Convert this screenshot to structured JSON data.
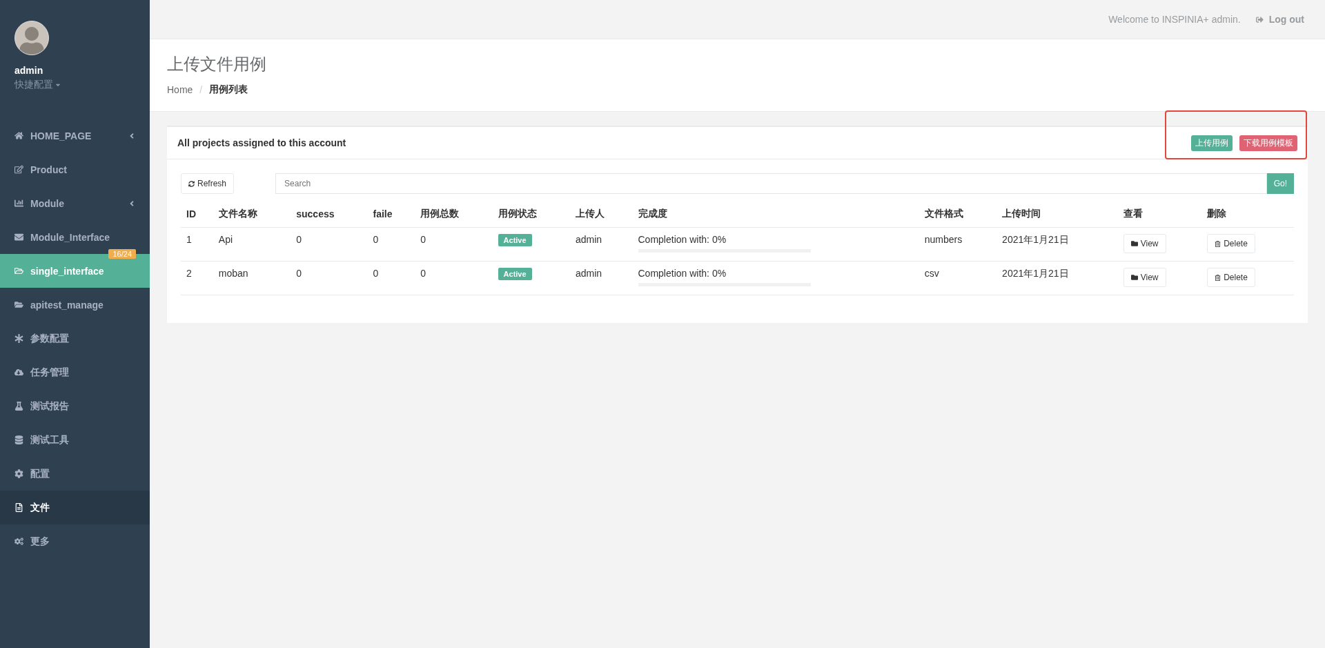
{
  "sidebar": {
    "user": {
      "name": "admin",
      "menu": "快捷配置"
    },
    "items": [
      {
        "label": "HOME_PAGE",
        "selected": false,
        "highlighted": false,
        "has_submenu": true
      },
      {
        "label": "Product",
        "selected": false,
        "highlighted": false,
        "has_submenu": false
      },
      {
        "label": "Module",
        "selected": false,
        "highlighted": false,
        "has_submenu": true
      },
      {
        "label": "Module_Interface",
        "selected": false,
        "highlighted": false,
        "has_submenu": false,
        "badge": "16/24"
      },
      {
        "label": "single_interface",
        "selected": true,
        "highlighted": false,
        "has_submenu": false
      },
      {
        "label": "apitest_manage",
        "selected": false,
        "highlighted": false,
        "has_submenu": false
      },
      {
        "label": "参数配置",
        "selected": false,
        "highlighted": false,
        "has_submenu": false
      },
      {
        "label": "任务管理",
        "selected": false,
        "highlighted": false,
        "has_submenu": false
      },
      {
        "label": "测试报告",
        "selected": false,
        "highlighted": false,
        "has_submenu": false
      },
      {
        "label": "测试工具",
        "selected": false,
        "highlighted": false,
        "has_submenu": false
      },
      {
        "label": "配置",
        "selected": false,
        "highlighted": false,
        "has_submenu": false
      },
      {
        "label": "文件",
        "selected": false,
        "highlighted": true,
        "has_submenu": false
      },
      {
        "label": "更多",
        "selected": false,
        "highlighted": false,
        "has_submenu": false
      }
    ]
  },
  "top_bar": {
    "welcome": "Welcome to INSPINIA+ admin.",
    "logout": "Log out"
  },
  "page_heading": {
    "title": "上传文件用例",
    "breadcrumb": [
      "Home",
      "用例列表"
    ],
    "separator": "/"
  },
  "panel": {
    "title": "All projects assigned to this account",
    "buttons": [
      {
        "label": "上传用例",
        "kind": "primary"
      },
      {
        "label": "下载用例模板",
        "kind": "danger"
      }
    ],
    "refresh": "Refresh",
    "search": {
      "placeholder": "Search"
    },
    "go": "Go!",
    "table": {
      "columns": [
        "ID",
        "文件名称",
        "success",
        "faile",
        "用例总数",
        "用例状态",
        "上传人",
        "完成度",
        "文件格式",
        "上传时间",
        "查看",
        "删除"
      ],
      "rows": [
        {
          "id": "1",
          "name": "Api",
          "success": "0",
          "faile": "0",
          "total": "0",
          "status": "Active",
          "uploader": "admin",
          "completion": "Completion with: 0%",
          "level": 0,
          "format": "numbers",
          "time": "2021年1月21日",
          "view": "View",
          "delete": "Delete"
        },
        {
          "id": "2",
          "name": "moban",
          "success": "0",
          "faile": "0",
          "total": "0",
          "status": "Active",
          "uploader": "admin",
          "completion": "Completion with: 0%",
          "level": 0,
          "format": "csv",
          "time": "2021年1月21日",
          "view": "View",
          "delete": "Delete"
        }
      ]
    }
  }
}
